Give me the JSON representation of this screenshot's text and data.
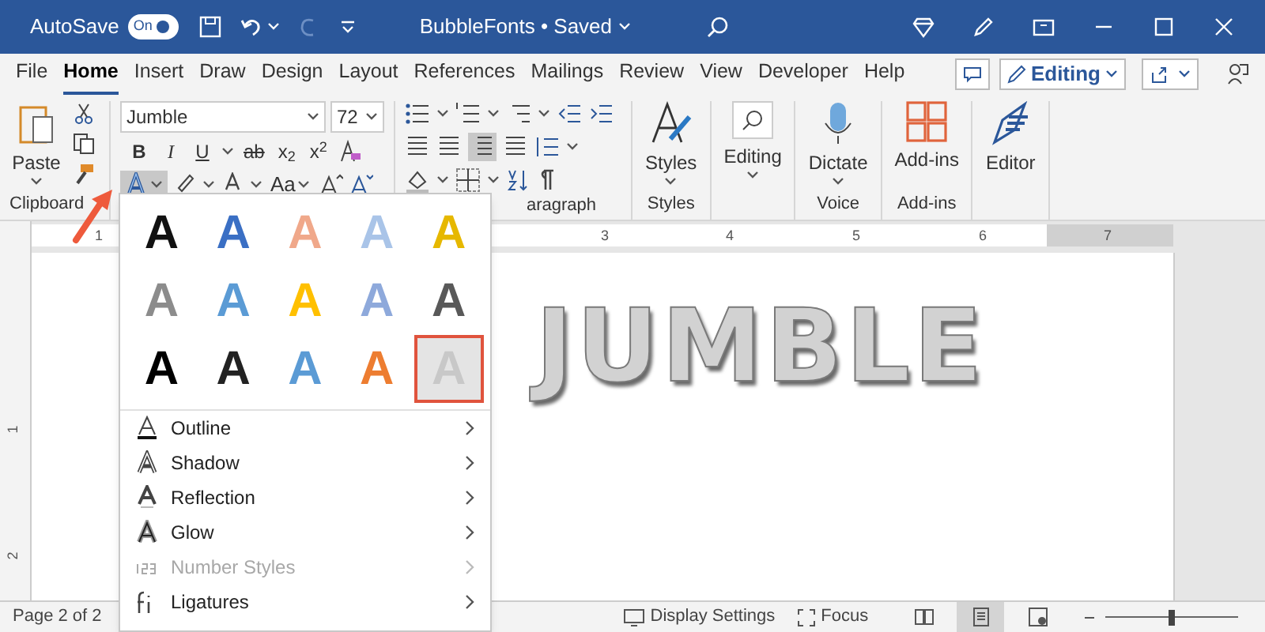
{
  "title_bar": {
    "autosave_label": "AutoSave",
    "autosave_toggle": {
      "label": "On",
      "on": true
    },
    "document_title": "BubbleFonts • Saved"
  },
  "menu_tabs": [
    {
      "label": "File",
      "selected": false
    },
    {
      "label": "Home",
      "selected": true
    },
    {
      "label": "Insert",
      "selected": false
    },
    {
      "label": "Draw",
      "selected": false
    },
    {
      "label": "Design",
      "selected": false
    },
    {
      "label": "Layout",
      "selected": false
    },
    {
      "label": "References",
      "selected": false
    },
    {
      "label": "Mailings",
      "selected": false
    },
    {
      "label": "Review",
      "selected": false
    },
    {
      "label": "View",
      "selected": false
    },
    {
      "label": "Developer",
      "selected": false
    },
    {
      "label": "Help",
      "selected": false
    }
  ],
  "editing_mode": "Editing",
  "clipboard": {
    "paste": "Paste",
    "label": "Clipboard"
  },
  "font": {
    "font_name": "Jumble",
    "font_size": "72",
    "format_buttons": [
      "B",
      "I",
      "U",
      "ab",
      "x$_{2}$",
      "x$^{2}$"
    ],
    "change_case": "Aa"
  },
  "paragraph": {
    "label": "aragraph"
  },
  "styles": {
    "button": "Styles",
    "label": "Styles"
  },
  "editing": {
    "button": "Editing"
  },
  "voice": {
    "button": "Dictate",
    "label": "Voice"
  },
  "add_ins": {
    "button": "Add-ins",
    "label": "Add-ins"
  },
  "editor": {
    "button": "Editor"
  },
  "ruler": {
    "numbers": [
      "1",
      "3",
      "4",
      "5",
      "6",
      "7"
    ],
    "vertical_numbers": [
      "1",
      "2"
    ]
  },
  "document": {
    "word_art": "JUMBLE"
  },
  "text_effects_menu": {
    "styles": [
      {
        "label": "A",
        "color": "#111111",
        "selected": false
      },
      {
        "label": "A",
        "color": "#3a6fc4",
        "selected": false
      },
      {
        "label": "A",
        "color": "#f0a88a",
        "selected": false
      },
      {
        "label": "A",
        "color": "#a9c4e8",
        "selected": false
      },
      {
        "label": "A",
        "color": "#e6b800",
        "selected": false
      },
      {
        "label": "A",
        "color": "#8c8c8c",
        "selected": false
      },
      {
        "label": "A",
        "color": "#5b9bd5",
        "selected": false
      },
      {
        "label": "A",
        "color": "#ffc000",
        "selected": false
      },
      {
        "label": "A",
        "color": "#8ea9db",
        "selected": false
      },
      {
        "label": "A",
        "color": "#595959",
        "selected": false
      },
      {
        "label": "A",
        "color": "#000000",
        "selected": false
      },
      {
        "label": "A",
        "color": "#222222",
        "selected": false
      },
      {
        "label": "A",
        "color": "#5b9bd5",
        "selected": false
      },
      {
        "label": "A",
        "color": "#ed7d31",
        "selected": false
      },
      {
        "label": "A",
        "color": "#c8c8c8",
        "selected": true
      }
    ],
    "items": [
      {
        "label": "Outline",
        "disabled": false
      },
      {
        "label": "Shadow",
        "disabled": false
      },
      {
        "label": "Reflection",
        "disabled": false
      },
      {
        "label": "Glow",
        "disabled": false
      },
      {
        "label": "Number Styles",
        "disabled": true
      },
      {
        "label": "Ligatures",
        "disabled": false
      }
    ]
  },
  "status_bar": {
    "page": "Page 2 of 2",
    "display_settings": "Display Settings",
    "focus": "Focus",
    "views": [
      {
        "kind": "read",
        "selected": false
      },
      {
        "kind": "print",
        "selected": true
      },
      {
        "kind": "web",
        "selected": false
      }
    ],
    "zoom": {
      "level": 0.5
    }
  }
}
